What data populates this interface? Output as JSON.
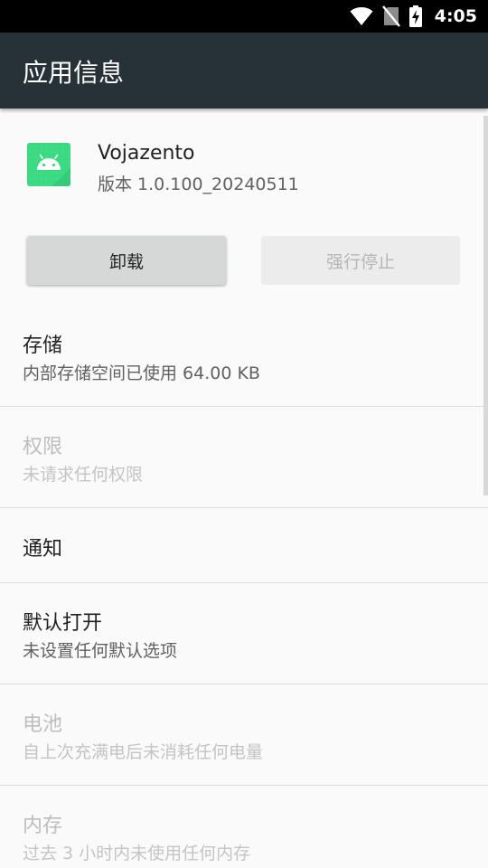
{
  "status_bar": {
    "time": "4:05",
    "icons": [
      "wifi-icon",
      "no-sim-icon",
      "battery-charging-icon"
    ]
  },
  "toolbar": {
    "title": "应用信息"
  },
  "app": {
    "name": "Vojazento",
    "version": "版本 1.0.100_20240511",
    "icon": "android-icon",
    "icon_color": "#3ddc84"
  },
  "buttons": {
    "uninstall_label": "卸载",
    "force_stop_label": "强行停止"
  },
  "items": [
    {
      "title": "存储",
      "summary": "内部存储空间已使用 64.00 KB",
      "enabled": true
    },
    {
      "title": "权限",
      "summary": "未请求任何权限",
      "enabled": false
    },
    {
      "title": "通知",
      "summary": "",
      "enabled": true
    },
    {
      "title": "默认打开",
      "summary": "未设置任何默认选项",
      "enabled": true
    },
    {
      "title": "电池",
      "summary": "自上次充满电后未消耗任何电量",
      "enabled": false
    },
    {
      "title": "内存",
      "summary": "过去 3 小时内未使用任何内存",
      "enabled": false
    }
  ],
  "colors": {
    "toolbar": "#263238",
    "status_bar": "#000000",
    "background": "#fafafa",
    "accent": "#3ddc84"
  }
}
